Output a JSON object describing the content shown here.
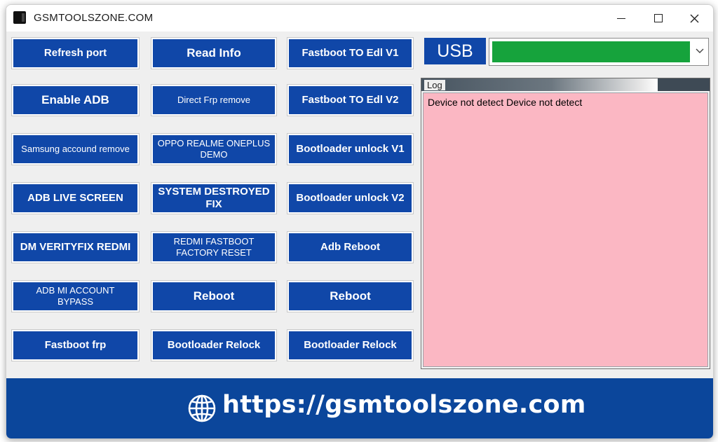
{
  "window": {
    "title": "GSMTOOLSZONE.COM"
  },
  "buttons": {
    "refresh_port": "Refresh port",
    "read_info": "Read Info",
    "fastboot_edl_v1": "Fastboot TO Edl V1",
    "enable_adb": "Enable ADB",
    "direct_frp": "Direct Frp remove",
    "fastboot_edl_v2": "Fastboot TO Edl V2",
    "samsung_account": "Samsung accound remove",
    "oppo_demo": "OPPO REALME ONEPLUS DEMO",
    "bootloader_unlock_v1": "Bootloader unlock V1",
    "adb_live_screen": "ADB LIVE SCREEN",
    "system_destroyed": "SYSTEM DESTROYED FIX",
    "bootloader_unlock_v2": "Bootloader unlock V2",
    "dm_verity": "DM VERITYFIX REDMI",
    "redmi_factory_reset": "REDMI FASTBOOT FACTORY RESET",
    "adb_reboot": "Adb Reboot",
    "adb_mi_bypass": "ADB MI ACCOUNT BYPASS",
    "reboot_1": "Reboot",
    "reboot_2": "Reboot",
    "fastboot_frp": "Fastboot frp",
    "bootloader_relock_1": "Bootloader Relock",
    "bootloader_relock_2": "Bootloader Relock"
  },
  "connection": {
    "label": "USB",
    "selected_value": "",
    "status_color": "#16a33c"
  },
  "log": {
    "title": "Log",
    "text": "Device not detect Device not detect",
    "background": "#fbb7c3"
  },
  "footer": {
    "url": "https://gsmtoolszone.com",
    "icon": "globe-icon"
  },
  "colors": {
    "accent": "#1047a8",
    "footer": "#0b469b"
  }
}
